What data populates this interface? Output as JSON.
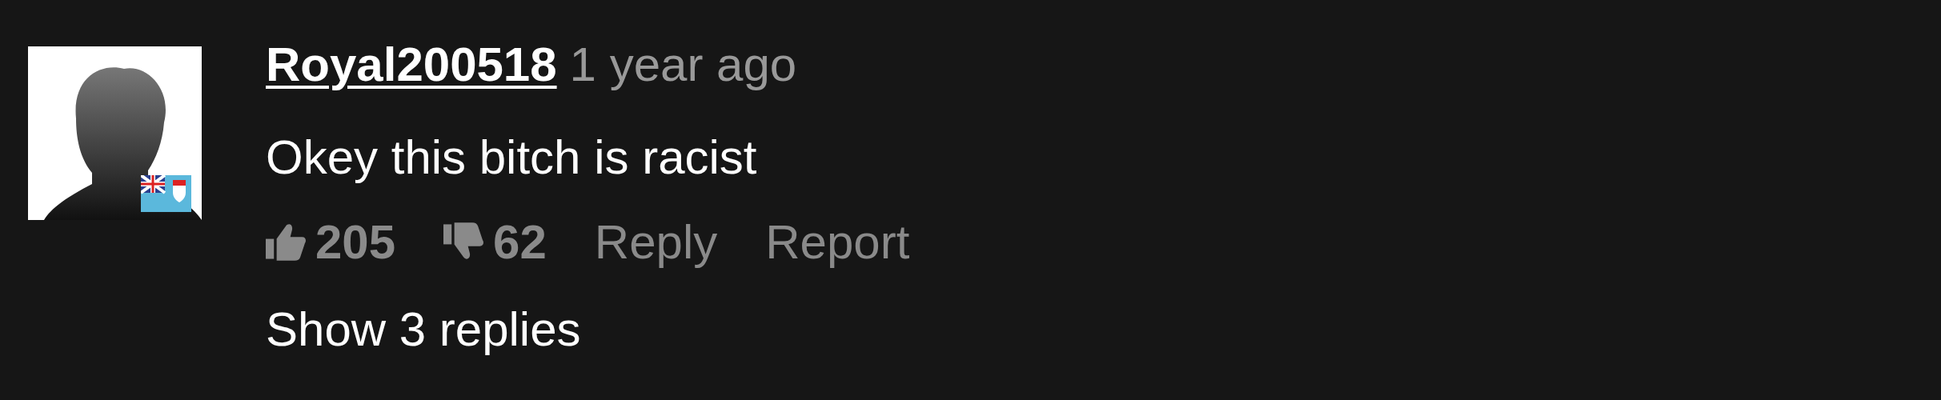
{
  "comment": {
    "author": "Royal200518",
    "time": "1 year ago",
    "text": "Okey this bitch is racist",
    "likes": "205",
    "dislikes": "62",
    "reply_label": "Reply",
    "report_label": "Report",
    "show_replies": "Show 3 replies"
  }
}
